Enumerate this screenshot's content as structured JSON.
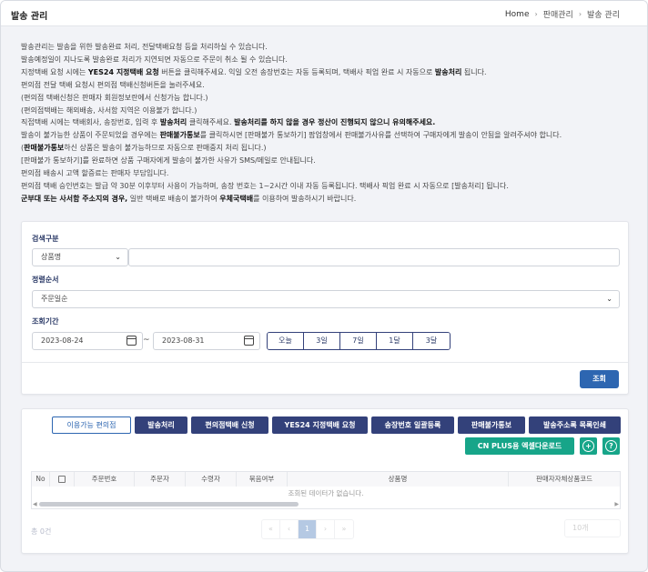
{
  "header": {
    "title": "발송 관리",
    "breadcrumb": [
      "Home",
      "판매관리",
      "발송 관리"
    ]
  },
  "notice_lines": [
    [
      {
        "t": "발송관리는 발송을 위한 발송완료 처리, 전달택배요청 등을 처리하실 수 있습니다."
      }
    ],
    [
      {
        "t": "발송예정일이 지나도록 발송완료 처리가 지연되면 자동으로 주문이 취소 될 수 있습니다."
      }
    ],
    [
      {
        "t": "지정택배 요청 시에는 "
      },
      {
        "t": "YES24 지정택배 요청",
        "b": true
      },
      {
        "t": " 버튼을 클릭해주세요. 익일 오전 송장번호는 자동 등록되며, 택배사 픽업 완료 시 자동으로 "
      },
      {
        "t": "발송처리",
        "b": true
      },
      {
        "t": " 됩니다."
      }
    ],
    [
      {
        "t": "편의점 전달 택배 요청시 편의점 택배신청버튼을 눌러주세요."
      }
    ],
    [
      {
        "t": "(편의점 택배신청은 판매자 회원정보란에서 신청가능 합니다.)"
      }
    ],
    [
      {
        "t": "(편의점택배는 해외배송, 사서함 지역은 이용불가 합니다.)"
      }
    ],
    [
      {
        "t": "직접택배 시에는 택배회사, 송장번호, 입력 후 "
      },
      {
        "t": "발송처리",
        "b": true
      },
      {
        "t": " 클릭해주세요. "
      },
      {
        "t": "발송처리를 하지 않을 경우 정산이 진행되지 않으니 유의해주세요.",
        "b": true
      }
    ],
    [
      {
        "t": "발송이 불가능한 상품이 주문되었을 경우에는 "
      },
      {
        "t": "판매불가통보",
        "b": true
      },
      {
        "t": "를 클릭하시면 [판매불가 통보하기] 팝업창에서 판매불가사유를 선택하여 구매자에게 발송이 안됨을 알려주셔야 합니다."
      }
    ],
    [
      {
        "t": "("
      },
      {
        "t": "판매불가통보",
        "b": true
      },
      {
        "t": "하신 상품은 발송이 불가능하므로 자동으로 판매중지 처리 됩니다.)"
      }
    ],
    [
      {
        "t": "[판매불가 통보하기]를 완료하면 상품 구매자에게 발송이 불가한 사유가 SMS/메일로 안내됩니다."
      }
    ],
    [
      {
        "t": "편의점 배송시 고액 할증료는 판매자 부담입니다."
      }
    ],
    [
      {
        "t": "편의점 택배 승인번호는 발급 약 30분 이후부터 사용이 가능하며, 송장 번호는 1~2시간 이내 자동 등록됩니다. 택배사 픽업 완료 시 자동으로 [발송처리] 됩니다."
      }
    ],
    [
      {
        "t": "군부대 또는 사서함 주소지의 경우,",
        "b": true
      },
      {
        "t": " 일반 택배로 배송이 불가하여 "
      },
      {
        "t": "우체국택배",
        "b": true
      },
      {
        "t": "를 이용하여 발송하시기 바랍니다."
      }
    ]
  ],
  "search": {
    "category_label": "검색구분",
    "category_value": "상품명",
    "keyword_value": "",
    "sort_label": "정렬순서",
    "sort_value": "주문일순",
    "period_label": "조회기간",
    "date_from": "2023-08-24",
    "date_to": "2023-08-31",
    "tilde": "~",
    "periods": [
      "오늘",
      "3일",
      "7일",
      "1달",
      "3달"
    ],
    "submit_label": "조회"
  },
  "actions": {
    "buttons": [
      "이용가능 편의점",
      "발송처리",
      "편의점택배 신청",
      "YES24 지정택배 요청",
      "송장번호 일괄등록",
      "판매불가통보",
      "발송주소록 목록인쇄"
    ],
    "excel_label": "CN PLUS용 엑셀다운로드",
    "add_icon": "plus-circle-icon",
    "help_icon": "question-circle-icon",
    "add_glyph": "+",
    "help_glyph": "?"
  },
  "table": {
    "columns": [
      "No",
      "",
      "주문번호",
      "주문자",
      "수령자",
      "묶음여부",
      "상품명",
      "판매자자체상품코드"
    ],
    "empty_message": "조회된 데이터가 없습니다."
  },
  "footer": {
    "total_label": "총 0건",
    "pages": [
      "«",
      "‹",
      "1",
      "›",
      "»"
    ],
    "current_page": "1",
    "page_size": "10개"
  },
  "colors": {
    "navy": "#33417a",
    "primary": "#2d66b1",
    "green": "#17a589"
  }
}
